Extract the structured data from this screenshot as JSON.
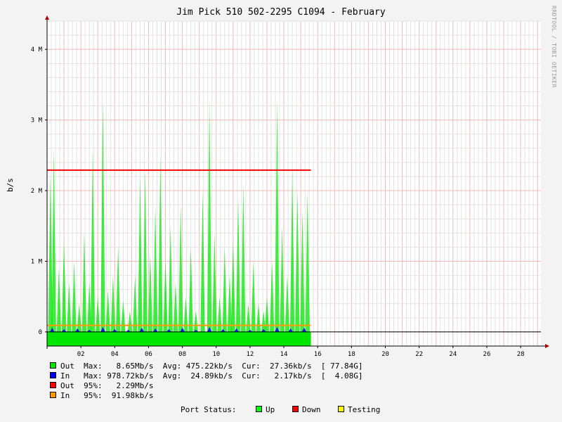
{
  "chart_data": {
    "type": "area",
    "title": "Jim Pick 510 502-2295 C1094 - February",
    "ylabel": "b/s",
    "watermark": "RRDTOOL / TOBI OETIKER",
    "ylim": [
      -200000,
      4400000
    ],
    "y_ticks": [
      {
        "value": 0,
        "label": "0"
      },
      {
        "value": 1000000,
        "label": "1 M"
      },
      {
        "value": 2000000,
        "label": "2 M"
      },
      {
        "value": 3000000,
        "label": "3 M"
      },
      {
        "value": 4000000,
        "label": "4 M"
      }
    ],
    "xlim": [
      1,
      30.2
    ],
    "x_ticks": [
      {
        "value": 3,
        "label": "02"
      },
      {
        "value": 5,
        "label": "04"
      },
      {
        "value": 7,
        "label": "06"
      },
      {
        "value": 9,
        "label": "08"
      },
      {
        "value": 11,
        "label": "10"
      },
      {
        "value": 13,
        "label": "12"
      },
      {
        "value": 15,
        "label": "14"
      },
      {
        "value": 17,
        "label": "16"
      },
      {
        "value": 19,
        "label": "18"
      },
      {
        "value": 21,
        "label": "20"
      },
      {
        "value": 23,
        "label": "22"
      },
      {
        "value": 25,
        "label": "24"
      },
      {
        "value": 27,
        "label": "26"
      },
      {
        "value": 29,
        "label": "28"
      }
    ],
    "data_end_x": 16.6,
    "series": [
      {
        "name": "Out",
        "color": "#00e600",
        "kind": "area",
        "spikes": [
          [
            1.2,
            2250000
          ],
          [
            1.4,
            2600000
          ],
          [
            1.7,
            900000
          ],
          [
            2.0,
            1300000
          ],
          [
            2.3,
            700000
          ],
          [
            2.6,
            1000000
          ],
          [
            2.9,
            400000
          ],
          [
            3.2,
            1400000
          ],
          [
            3.5,
            700000
          ],
          [
            3.7,
            2600000
          ],
          [
            4.0,
            500000
          ],
          [
            4.3,
            3300000
          ],
          [
            4.6,
            600000
          ],
          [
            4.9,
            800000
          ],
          [
            5.2,
            1200000
          ],
          [
            5.5,
            450000
          ],
          [
            5.9,
            300000
          ],
          [
            6.2,
            800000
          ],
          [
            6.5,
            2200000
          ],
          [
            6.8,
            2300000
          ],
          [
            7.1,
            1100000
          ],
          [
            7.4,
            1800000
          ],
          [
            7.7,
            2500000
          ],
          [
            8.0,
            1000000
          ],
          [
            8.3,
            1500000
          ],
          [
            8.6,
            700000
          ],
          [
            8.9,
            1800000
          ],
          [
            9.2,
            500000
          ],
          [
            9.5,
            1200000
          ],
          [
            9.8,
            300000
          ],
          [
            10.2,
            2000000
          ],
          [
            10.6,
            3300000
          ],
          [
            10.9,
            1400000
          ],
          [
            11.2,
            500000
          ],
          [
            11.5,
            1200000
          ],
          [
            11.8,
            800000
          ],
          [
            12.0,
            1300000
          ],
          [
            12.3,
            1900000
          ],
          [
            12.6,
            2100000
          ],
          [
            12.9,
            400000
          ],
          [
            13.2,
            1000000
          ],
          [
            13.5,
            400000
          ],
          [
            13.8,
            300000
          ],
          [
            14.0,
            500000
          ],
          [
            14.3,
            1000000
          ],
          [
            14.6,
            3300000
          ],
          [
            14.9,
            1500000
          ],
          [
            15.2,
            800000
          ],
          [
            15.5,
            2300000
          ],
          [
            15.8,
            2000000
          ],
          [
            16.1,
            1700000
          ],
          [
            16.4,
            2000000
          ]
        ]
      },
      {
        "name": "In",
        "color": "#0000ff",
        "kind": "area",
        "spikes": [
          [
            1.3,
            60000
          ],
          [
            2.0,
            40000
          ],
          [
            2.8,
            50000
          ],
          [
            3.5,
            30000
          ],
          [
            4.3,
            70000
          ],
          [
            5.0,
            40000
          ],
          [
            5.8,
            30000
          ],
          [
            6.6,
            60000
          ],
          [
            7.4,
            50000
          ],
          [
            8.2,
            40000
          ],
          [
            9.0,
            60000
          ],
          [
            9.8,
            30000
          ],
          [
            10.6,
            70000
          ],
          [
            11.4,
            40000
          ],
          [
            12.2,
            50000
          ],
          [
            13.0,
            30000
          ],
          [
            13.8,
            40000
          ],
          [
            14.6,
            70000
          ],
          [
            15.4,
            50000
          ],
          [
            16.2,
            60000
          ]
        ]
      },
      {
        "name": "Out 95%",
        "color": "#ff0000",
        "kind": "line",
        "value": 2290000
      },
      {
        "name": "In 95%",
        "color": "#ff9900",
        "kind": "line",
        "value": 91980
      }
    ],
    "legend": [
      {
        "color": "#00e600",
        "text": "Out  Max:   8.65Mb/s  Avg: 475.22kb/s  Cur:  27.36kb/s  [ 77.84G]"
      },
      {
        "color": "#0000ff",
        "text": "In   Max: 978.72kb/s  Avg:  24.89kb/s  Cur:   2.17kb/s  [  4.08G]"
      },
      {
        "color": "#ff0000",
        "text": "Out  95%:   2.29Mb/s"
      },
      {
        "color": "#ff9900",
        "text": "In   95%:  91.98kb/s"
      }
    ],
    "port_status": {
      "label": "Port Status:",
      "items": [
        {
          "color": "#00ff00",
          "text": "Up"
        },
        {
          "color": "#ff0000",
          "text": "Down"
        },
        {
          "color": "#ffff00",
          "text": "Testing"
        }
      ]
    }
  }
}
